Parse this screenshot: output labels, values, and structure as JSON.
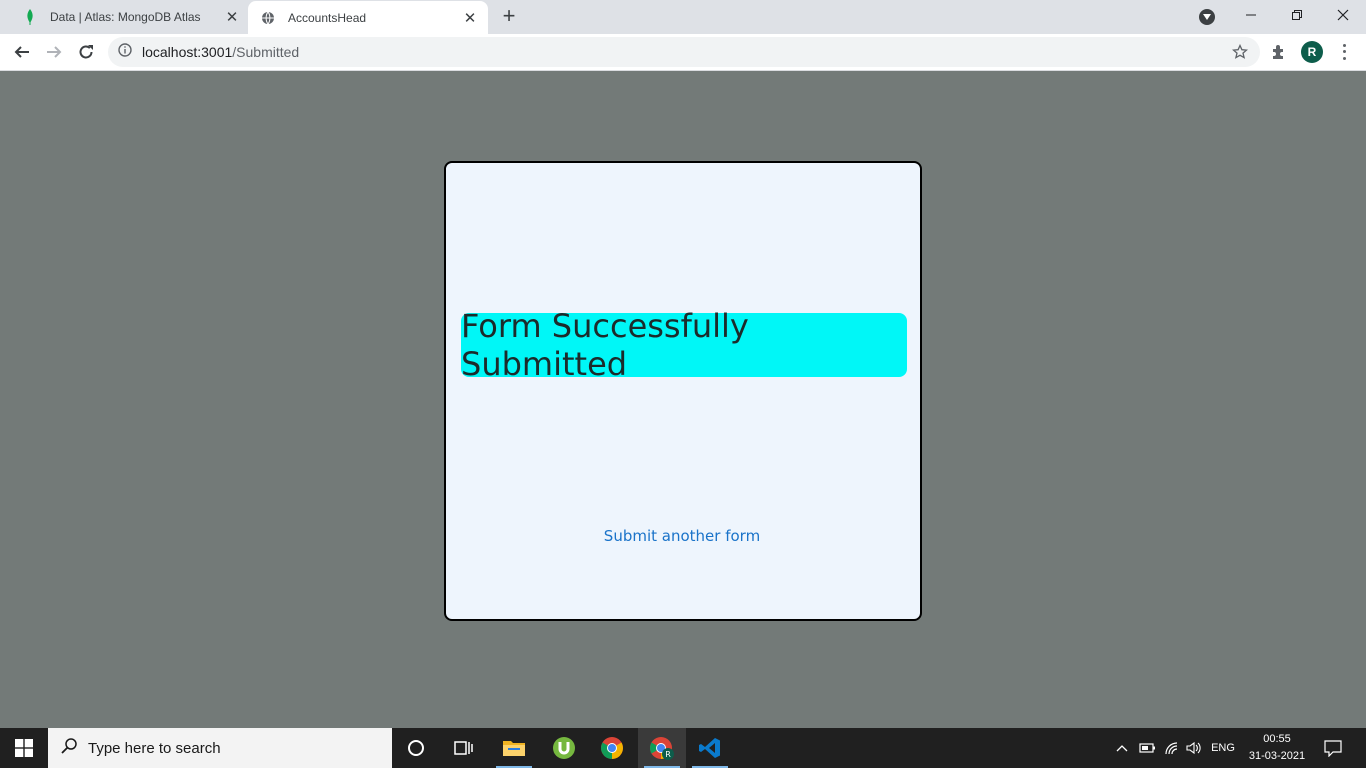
{
  "browser": {
    "tabs": [
      {
        "title": "Data | Atlas: MongoDB Atlas",
        "icon": "mongodb-leaf-icon",
        "active": false
      },
      {
        "title": "AccountsHead",
        "icon": "globe-icon",
        "active": true
      }
    ],
    "new_tab_label": "+",
    "url_host": "localhost:3001",
    "url_path": "/Submitted",
    "profile_initial": "R"
  },
  "page": {
    "banner_text": "Form Successfully Submitted",
    "link_text": "Submit another form",
    "colors": {
      "background": "#737a78",
      "card": "#eef5fd",
      "banner": "#00f7f7",
      "link": "#1a73c9"
    }
  },
  "taskbar": {
    "search_placeholder": "Type here to search",
    "language": "ENG",
    "time": "00:55",
    "date": "31-03-2021",
    "apps": [
      "cortana-circle-icon",
      "task-view-icon",
      "file-explorer-icon",
      "utorrent-icon",
      "chrome-icon",
      "chrome-profile-icon",
      "vscode-icon"
    ]
  }
}
